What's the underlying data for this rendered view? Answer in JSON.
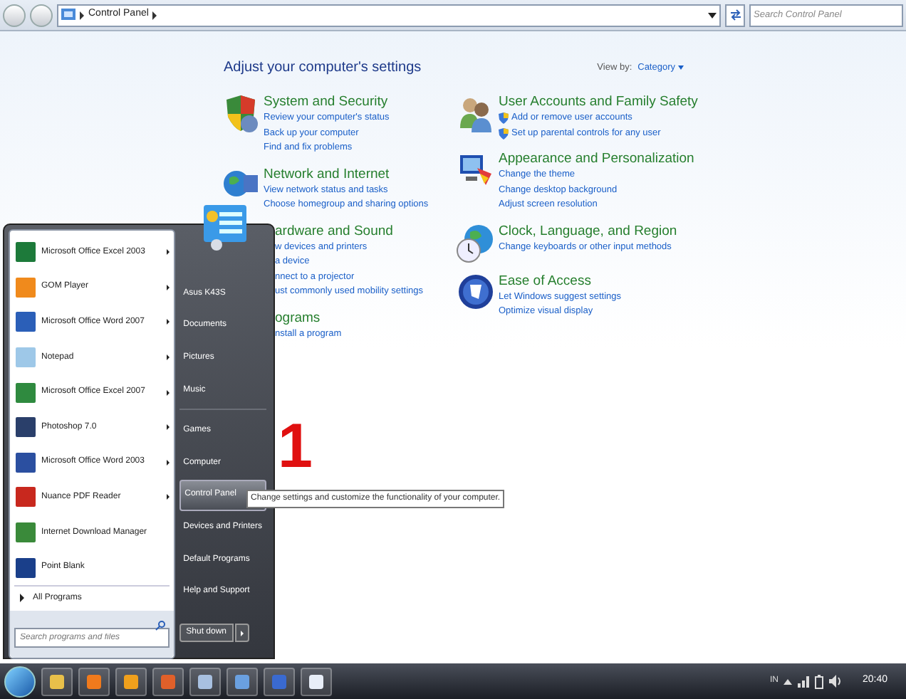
{
  "address_bar": {
    "path": "Control Panel",
    "search_placeholder": "Search Control Panel"
  },
  "header": {
    "title": "Adjust your computer's settings",
    "view_by_label": "View by:",
    "view_by_value": "Category"
  },
  "categories_left": [
    {
      "title": "System and Security",
      "links": [
        {
          "text": "Review your computer's status"
        },
        {
          "text": "Back up your computer"
        },
        {
          "text": "Find and fix problems"
        }
      ]
    },
    {
      "title": "Network and Internet",
      "links": [
        {
          "text": "View network status and tasks"
        },
        {
          "text": "Choose homegroup and sharing options"
        }
      ]
    },
    {
      "title": "ardware and Sound",
      "links": [
        {
          "text": "w devices and printers"
        },
        {
          "text": "a device"
        },
        {
          "text": "nnect to a projector"
        },
        {
          "text": "ust commonly used mobility settings"
        }
      ]
    },
    {
      "title": "ograms",
      "links": [
        {
          "text": "nstall a program"
        }
      ]
    }
  ],
  "categories_right": [
    {
      "title": "User Accounts and Family Safety",
      "links": [
        {
          "text": "Add or remove user accounts",
          "shielded": true
        },
        {
          "text": "Set up parental controls for any user",
          "shielded": true
        }
      ]
    },
    {
      "title": "Appearance and Personalization",
      "links": [
        {
          "text": "Change the theme"
        },
        {
          "text": "Change desktop background"
        },
        {
          "text": "Adjust screen resolution"
        }
      ]
    },
    {
      "title": "Clock, Language, and Region",
      "links": [
        {
          "text": "Change keyboards or other input methods"
        }
      ]
    },
    {
      "title": "Ease of Access",
      "links": [
        {
          "text": "Let Windows suggest settings"
        },
        {
          "text": "Optimize visual display"
        }
      ]
    }
  ],
  "start_menu": {
    "programs": [
      {
        "label": "Microsoft Office Excel 2003",
        "submenu": true
      },
      {
        "label": "GOM Player",
        "submenu": true
      },
      {
        "label": "Microsoft Office Word 2007",
        "submenu": true
      },
      {
        "label": "Notepad",
        "submenu": true
      },
      {
        "label": "Microsoft Office Excel 2007",
        "submenu": true
      },
      {
        "label": "Photoshop 7.0",
        "submenu": true
      },
      {
        "label": "Microsoft Office Word 2003",
        "submenu": true
      },
      {
        "label": "Nuance PDF Reader",
        "submenu": true
      },
      {
        "label": "Internet Download Manager",
        "submenu": false
      },
      {
        "label": "Point Blank",
        "submenu": false
      }
    ],
    "all_programs": "All Programs",
    "search_placeholder": "Search programs and files",
    "place_groups": [
      {
        "items": [
          {
            "label": "Asus K43S",
            "selected": false
          },
          {
            "label": "Documents",
            "selected": false
          },
          {
            "label": "Pictures",
            "selected": false
          },
          {
            "label": "Music",
            "selected": false
          }
        ]
      },
      {
        "items": [
          {
            "label": "Games",
            "selected": false
          },
          {
            "label": "Computer",
            "selected": false
          },
          {
            "label": "Control Panel",
            "selected": true
          },
          {
            "label": "Devices and Printers",
            "selected": false
          },
          {
            "label": "Default Programs",
            "selected": false
          },
          {
            "label": "Help and Support",
            "selected": false
          }
        ]
      }
    ],
    "shutdown": "Shut down"
  },
  "tooltip": "Change settings and customize the functionality of your computer.",
  "annotation": "1",
  "taskbar": {
    "language": "IN",
    "clock": "20:40"
  }
}
